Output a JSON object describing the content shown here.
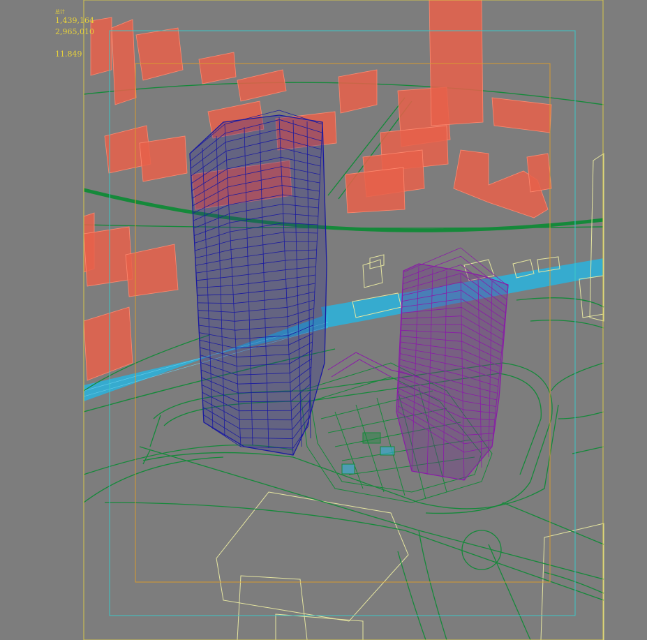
{
  "viewport": {
    "name": "3D Perspective Viewport",
    "background": "#7d7d7d"
  },
  "stats": {
    "label": "总计",
    "polys": "1,439,164",
    "verts": "2,965,010",
    "fps": "11.849"
  },
  "colors": {
    "stats_text": "#e8d23a",
    "safe_frame_outer": "#d8c84a",
    "safe_frame_cyan": "#3cc8c8",
    "safe_frame_inner": "#d89a30",
    "context_buildings": "#e8604a",
    "tower_main": "#1a1aa0",
    "tower_secondary": "#8a1aa8",
    "road_network": "#15893a",
    "river": "#2fb0d8",
    "outline_objects": "#e6e6a0"
  },
  "scene_objects": [
    {
      "name": "main-tower",
      "type": "wireframe-building"
    },
    {
      "name": "secondary-tower",
      "type": "wireframe-building"
    },
    {
      "name": "podium",
      "type": "wireframe-plaza"
    },
    {
      "name": "context-buildings",
      "type": "massing"
    },
    {
      "name": "river",
      "type": "water"
    },
    {
      "name": "road-network",
      "type": "lines"
    }
  ]
}
